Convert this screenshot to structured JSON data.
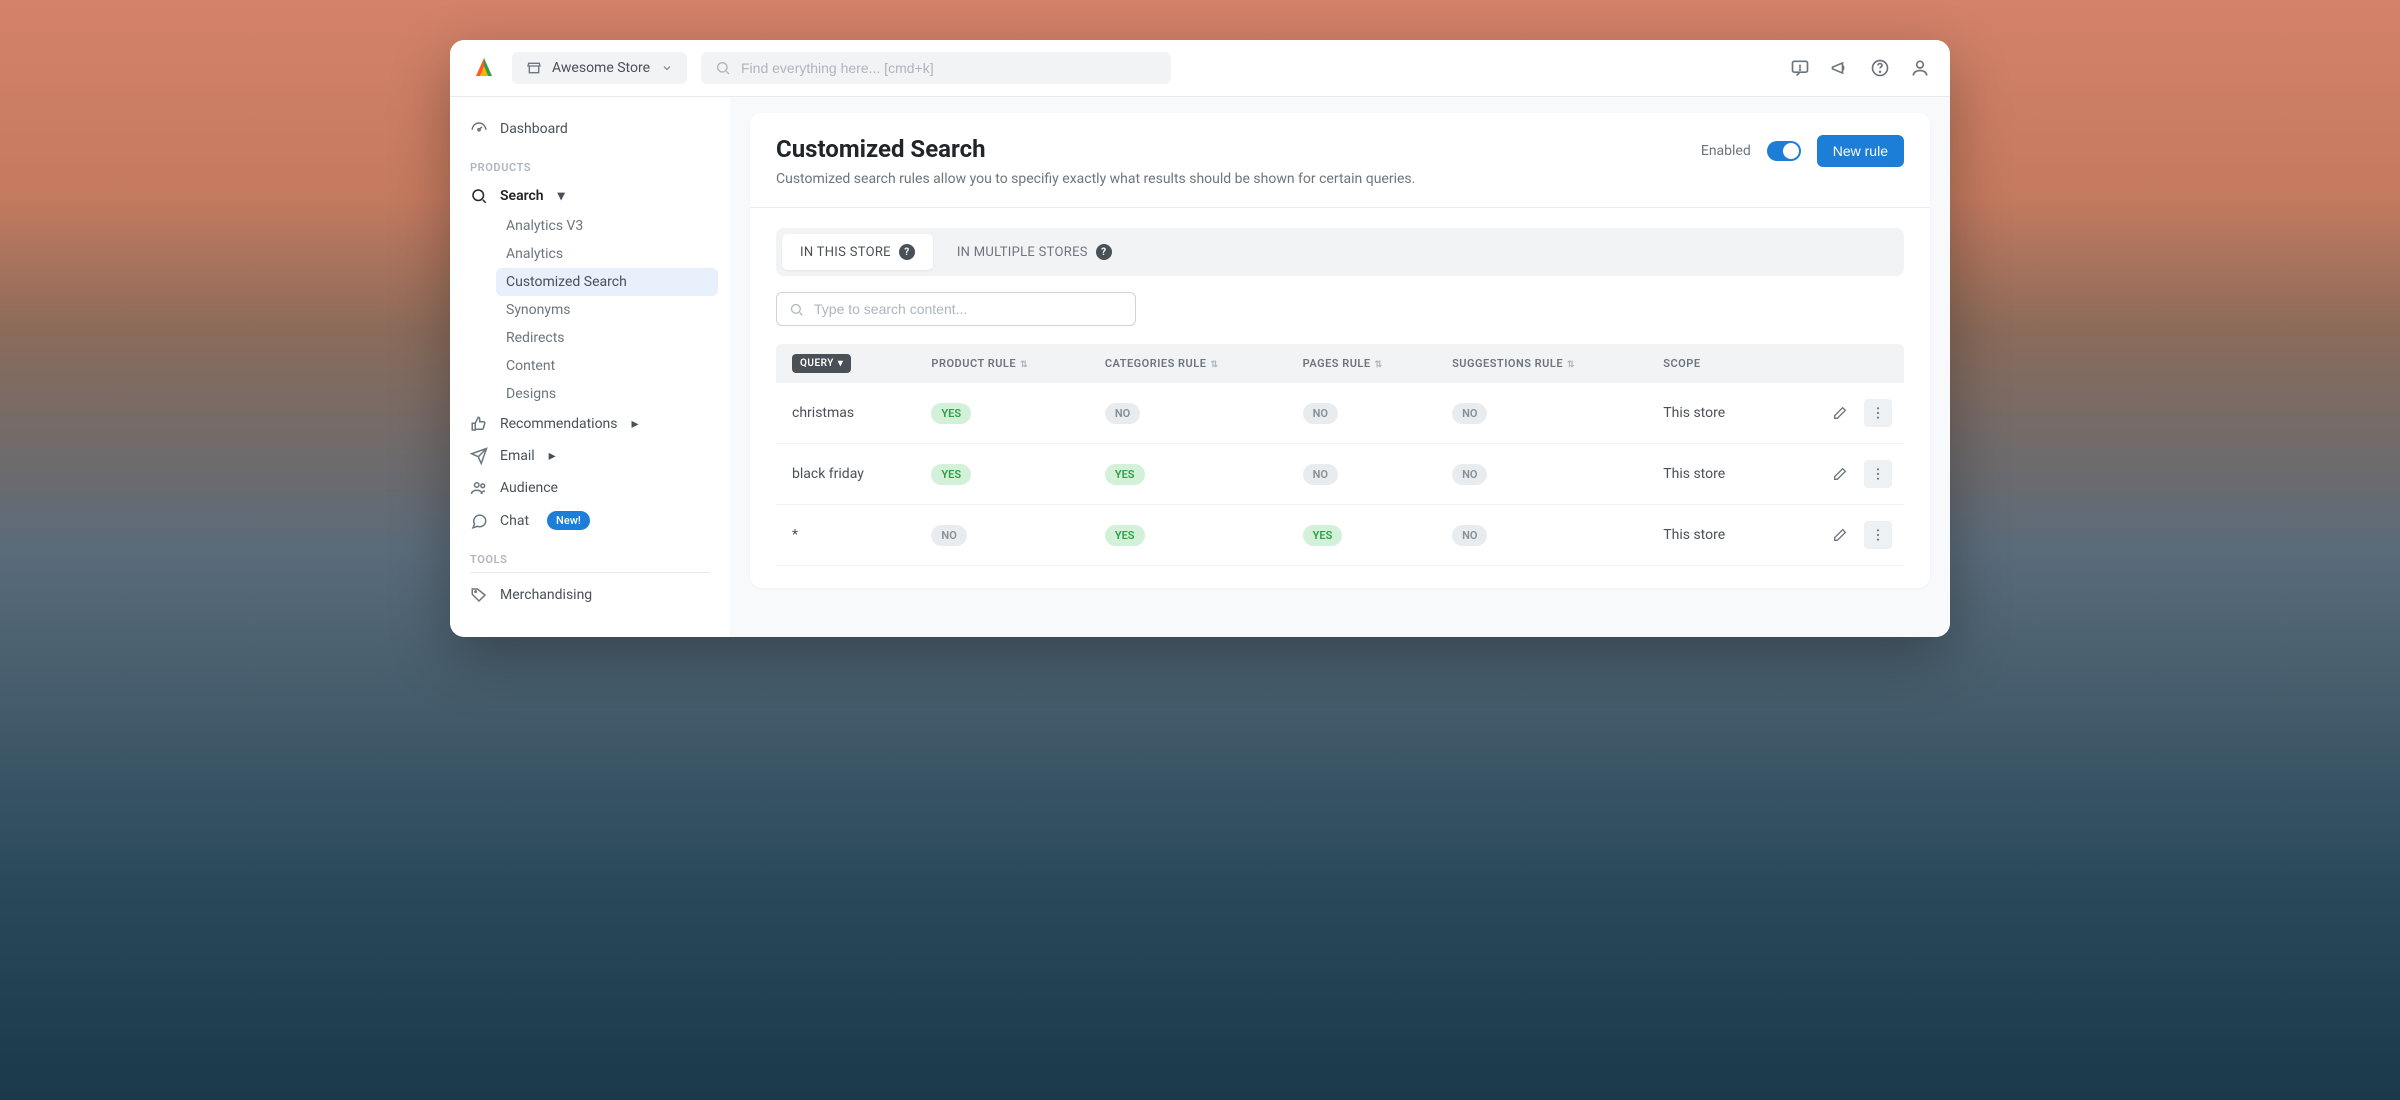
{
  "topbar": {
    "store_name": "Awesome Store",
    "search_placeholder": "Find everything here... [cmd+k]"
  },
  "sidebar": {
    "dashboard": "Dashboard",
    "section_products": "PRODUCTS",
    "search": "Search",
    "search_children": {
      "analytics_v3": "Analytics V3",
      "analytics": "Analytics",
      "customized_search": "Customized Search",
      "synonyms": "Synonyms",
      "redirects": "Redirects",
      "content": "Content",
      "designs": "Designs"
    },
    "recommendations": "Recommendations",
    "email": "Email",
    "audience": "Audience",
    "chat": "Chat",
    "chat_badge": "New!",
    "section_tools": "TOOLS",
    "merchandising": "Merchandising"
  },
  "page": {
    "title": "Customized Search",
    "subtitle": "Customized search rules allow you to specifiy exactly what results should be shown for certain queries.",
    "enabled_label": "Enabled",
    "new_rule_button": "New rule",
    "tabs": {
      "this_store": "IN THIS STORE",
      "multiple_stores": "IN MULTIPLE STORES"
    },
    "content_search_placeholder": "Type to search content...",
    "columns": {
      "query": "QUERY",
      "product_rule": "PRODUCT RULE",
      "categories_rule": "CATEGORIES RULE",
      "pages_rule": "PAGES RULE",
      "suggestions_rule": "SUGGESTIONS RULE",
      "scope": "SCOPE"
    },
    "yes": "YES",
    "no": "NO",
    "rows": [
      {
        "query": "christmas",
        "product": true,
        "categories": false,
        "pages": false,
        "suggestions": false,
        "scope": "This store"
      },
      {
        "query": "black friday",
        "product": true,
        "categories": true,
        "pages": false,
        "suggestions": false,
        "scope": "This store"
      },
      {
        "query": "*",
        "product": false,
        "categories": true,
        "pages": true,
        "suggestions": false,
        "scope": "This store"
      }
    ]
  }
}
